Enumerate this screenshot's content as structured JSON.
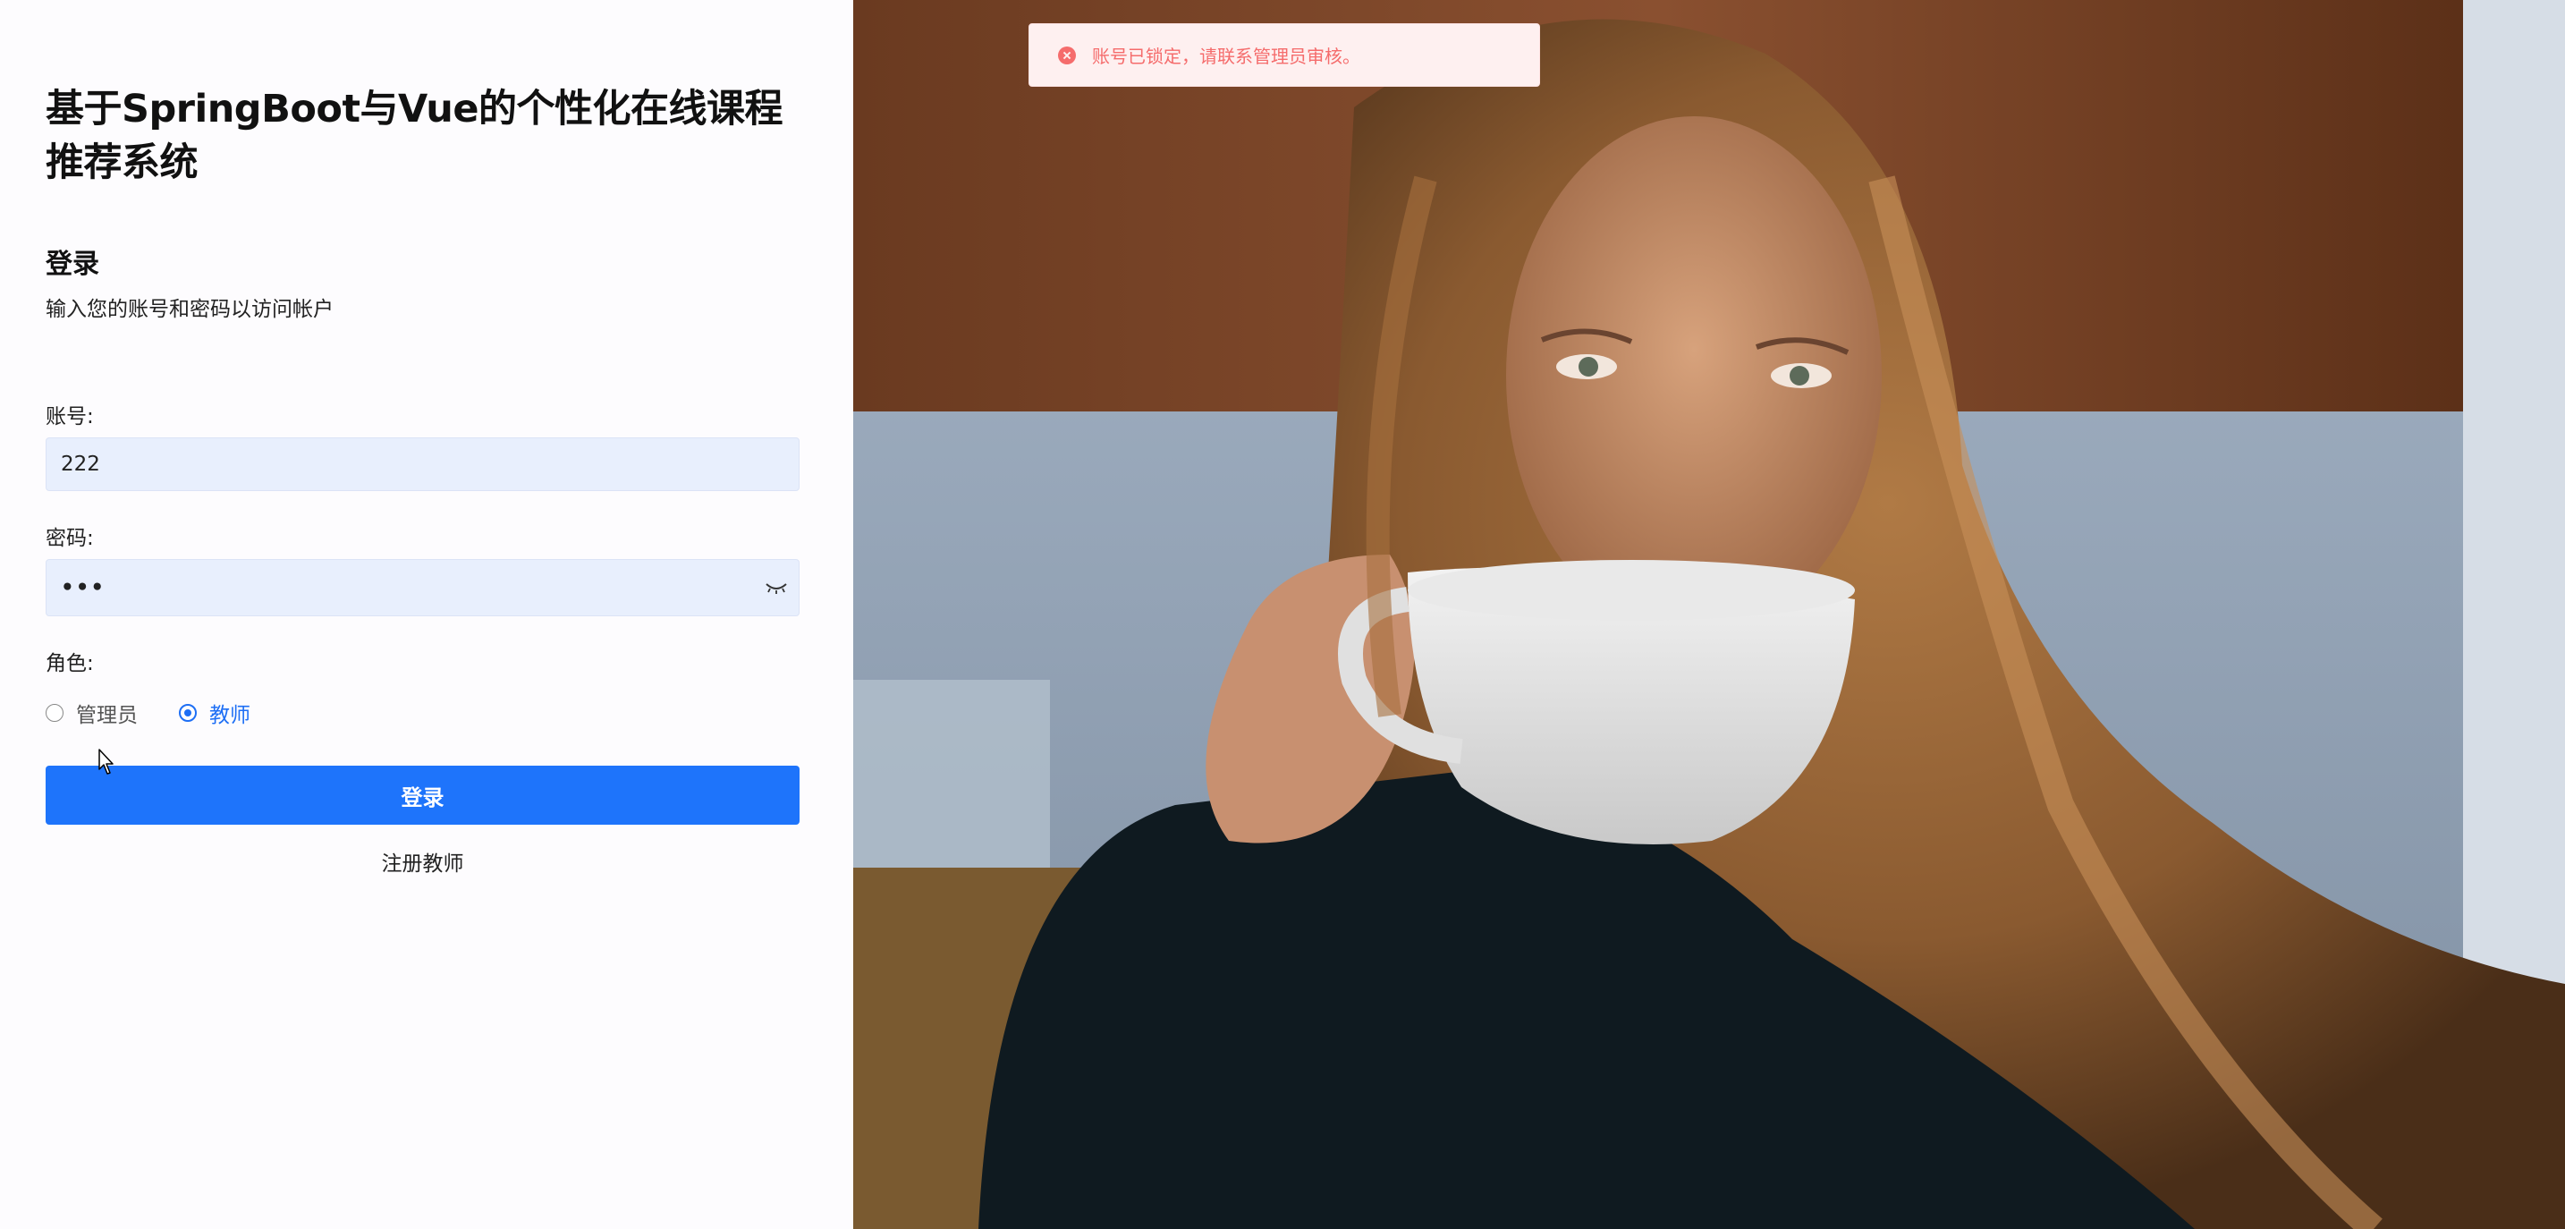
{
  "app": {
    "title": "基于SpringBoot与Vue的个性化在线课程推荐系统"
  },
  "login_form": {
    "heading": "登录",
    "subtitle": "输入您的账号和密码以访问帐户",
    "account_label": "账号:",
    "account_value": "222",
    "password_label": "密码:",
    "password_value": "•••",
    "role_label": "角色:",
    "roles": [
      {
        "label": "管理员",
        "checked": false
      },
      {
        "label": "教师",
        "checked": true
      }
    ],
    "submit_label": "登录",
    "register_link": "注册教师"
  },
  "toast": {
    "type": "error",
    "message": "账号已锁定，请联系管理员审核。"
  },
  "icons": {
    "toast": "error-circle-icon",
    "password_toggle": "eye-closed-icon",
    "cursor": "mouse-pointer-icon"
  },
  "colors": {
    "primary": "#1e74fb",
    "input_bg": "#e8effd",
    "error": "#f56c6c",
    "error_bg": "#fef0f0"
  }
}
